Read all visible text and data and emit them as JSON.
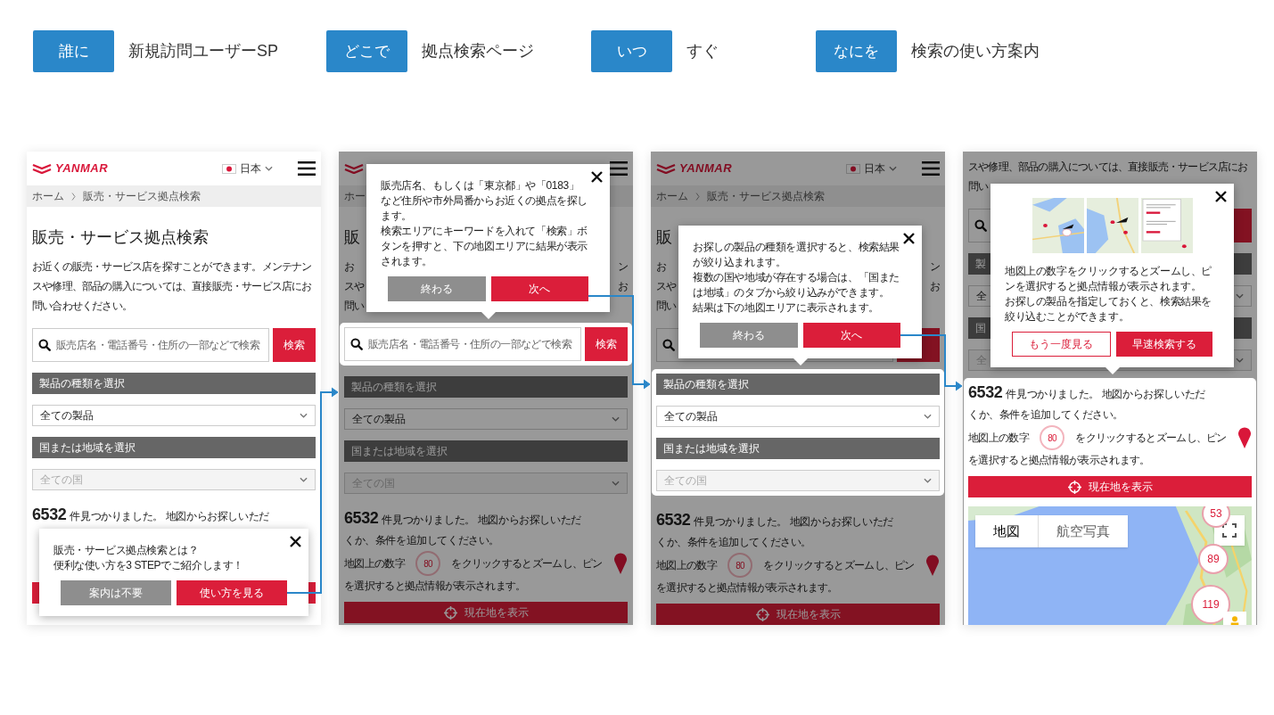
{
  "criteria": [
    {
      "label": "誰に",
      "value": "新規訪問ユーザーSP"
    },
    {
      "label": "どこで",
      "value": "拠点検索ページ"
    },
    {
      "label": "いつ",
      "value": "すぐ"
    },
    {
      "label": "なにを",
      "value": "検索の使い方案内"
    }
  ],
  "panels": [
    {
      "dimmed": false,
      "sections": [
        {
          "highlighted": false,
          "blocks": [
            {
              "kind": "header",
              "logo": "YANMAR",
              "country": "日本"
            },
            {
              "kind": "breadcrumb",
              "items": [
                "ホーム",
                "販売・サービス拠点検索"
              ]
            },
            {
              "kind": "title",
              "text": "販売・サービス拠点検索"
            },
            {
              "kind": "description",
              "lines": [
                {
                  "text": "お近くの販売・サービス店を探すことができます。メンテナン"
                },
                {
                  "text": "スや修理、部品の購入については、直接販売・サービス店にお"
                },
                {
                  "text": "問い合わせください。"
                }
              ]
            },
            {
              "kind": "search",
              "placeholder": "販売店名・電話番号・住所の一部などで検索",
              "button": "検索"
            },
            {
              "kind": "bar",
              "text": "製品の種類を選択"
            },
            {
              "kind": "select",
              "value": "全ての製品",
              "disabled": false
            },
            {
              "kind": "bar",
              "text": "国または地域を選択"
            },
            {
              "kind": "select",
              "value": "全ての国",
              "disabled": true
            },
            {
              "kind": "results",
              "count": "6532",
              "lines": [
                "件見つかりました。 地図からお探しいただ"
              ]
            },
            {
              "kind": "locate"
            }
          ]
        }
      ],
      "popup": {
        "lines": [
          "販売・サービス拠点検索とは？",
          "便利な使い方を3 STEPでご紹介します！"
        ],
        "buttons": [
          {
            "label": "案内は不要",
            "kind": "secondary"
          },
          {
            "label": "使い方を見る",
            "kind": "primary"
          }
        ]
      }
    },
    {
      "dimmed": true,
      "sections": [
        {
          "highlighted": false,
          "blocks": [
            {
              "kind": "header"
            },
            {
              "kind": "breadcrumb",
              "items": [
                "ホー"
              ]
            },
            {
              "kind": "title",
              "text": "販"
            },
            {
              "kind": "description",
              "lines": [
                {
                  "text": "お",
                  "tail": "ン"
                },
                {
                  "text": "スや",
                  "tail": "お"
                },
                {
                  "text": "問い"
                }
              ]
            }
          ]
        },
        {
          "highlighted": true,
          "blocks": [
            {
              "kind": "search",
              "placeholder": "販売店名・電話番号・住所の一部などで検索",
              "button": "検索"
            }
          ],
          "popup": {
            "lines": [
              "販売店名、もしくは「東京都」や「0183」など住所や市外局番からお近くの拠点を探します。",
              "検索エリアにキーワードを入れて「検索」ボタンを押すと、下の地図エリアに結果が表示されます。"
            ],
            "buttons": [
              {
                "label": "終わる",
                "kind": "secondary"
              },
              {
                "label": "次へ",
                "kind": "primary"
              }
            ]
          }
        },
        {
          "highlighted": false,
          "blocks": [
            {
              "kind": "bar",
              "text": "製品の種類を選択"
            },
            {
              "kind": "select",
              "value": "全ての製品",
              "disabled": false
            },
            {
              "kind": "bar",
              "text": "国または地域を選択"
            },
            {
              "kind": "select",
              "value": "全ての国",
              "disabled": true
            },
            {
              "kind": "results",
              "count": "6532",
              "lines": [
                "件見つかりました。 地図からお探しいただ",
                "くか、条件を追加してください。"
              ]
            },
            {
              "kind": "hint",
              "before": "地図上の数字",
              "marker": "80",
              "after": "をクリックするとズームし、ピン",
              "line2": "を選択すると拠点情報が表示されます。"
            },
            {
              "kind": "locate",
              "label": "現在地を表示"
            }
          ]
        }
      ]
    },
    {
      "dimmed": true,
      "sections": [
        {
          "highlighted": false,
          "blocks": [
            {
              "kind": "header",
              "logo": "YANMAR",
              "country": "日本"
            },
            {
              "kind": "breadcrumb",
              "items": [
                "ホーム",
                "販売・サービス拠点検索"
              ]
            },
            {
              "kind": "title",
              "text": "販"
            },
            {
              "kind": "description",
              "lines": [
                {
                  "text": "お",
                  "tail": "ン"
                },
                {
                  "text": "スや",
                  "tail": "お"
                },
                {
                  "text": "問い"
                }
              ]
            },
            {
              "kind": "search"
            }
          ]
        },
        {
          "highlighted": true,
          "blocks": [
            {
              "kind": "bar",
              "text": "製品の種類を選択"
            },
            {
              "kind": "select",
              "value": "全ての製品",
              "disabled": false
            },
            {
              "kind": "bar",
              "text": "国または地域を選択"
            },
            {
              "kind": "select",
              "value": "全ての国",
              "disabled": true
            }
          ],
          "popup": {
            "lines": [
              "お探しの製品の種類を選択すると、検索結果が絞り込まれます。",
              "複数の国や地域が存在する場合は、「国または地域」のタブから絞り込みができます。",
              "結果は下の地図エリアに表示されます。"
            ],
            "buttons": [
              {
                "label": "終わる",
                "kind": "secondary"
              },
              {
                "label": "次へ",
                "kind": "primary"
              }
            ]
          }
        },
        {
          "highlighted": false,
          "blocks": [
            {
              "kind": "results",
              "count": "6532",
              "lines": [
                "件見つかりました。 地図からお探しいただ",
                "くか、条件を追加してください。"
              ]
            },
            {
              "kind": "hint",
              "before": "地図上の数字",
              "marker": "80",
              "after": "をクリックするとズームし、ピン",
              "line2": "を選択すると拠点情報が表示されます。"
            },
            {
              "kind": "locate",
              "label": "現在地を表示"
            }
          ]
        }
      ]
    },
    {
      "dimmed": true,
      "sections": [
        {
          "highlighted": false,
          "blocks": [
            {
              "kind": "description",
              "lines": [
                {
                  "text": "スや修理、部品の購入については、直接販売・サービス店にお"
                },
                {
                  "text": "問い"
                }
              ]
            },
            {
              "kind": "search"
            },
            {
              "kind": "bar",
              "text": "製"
            },
            {
              "kind": "select",
              "value": "全",
              "disabled": false
            },
            {
              "kind": "bar",
              "text": "国"
            },
            {
              "kind": "select",
              "value": "全",
              "disabled": true
            }
          ]
        },
        {
          "highlighted": true,
          "blocks": [
            {
              "kind": "results",
              "count": "6532",
              "lines": [
                "件見つかりました。 地図からお探しいただ",
                "くか、条件を追加してください。"
              ]
            },
            {
              "kind": "hint",
              "before": "地図上の数字",
              "marker": "80",
              "after": "をクリックするとズームし、ピン",
              "line2": "を選択すると拠点情報が表示されます。"
            },
            {
              "kind": "locate",
              "label": "現在地を表示"
            },
            {
              "kind": "map",
              "tabs": [
                {
                  "label": "地図",
                  "selected": true
                },
                {
                  "label": "航空写真",
                  "selected": false
                }
              ],
              "markers": [
                "53",
                "89",
                "119"
              ]
            }
          ],
          "popup": {
            "images": [
              {
                "kind": "picture"
              },
              {
                "kind": "picture"
              },
              {
                "kind": "picture"
              }
            ],
            "lines": [
              "地図上の数字をクリックするとズームし、ピンを選択すると拠点情報が表示されます。",
              "お探しの製品を指定しておくと、検索結果を絞り込むことができます。"
            ],
            "buttons": [
              {
                "label": "もう一度見る",
                "kind": "outline"
              },
              {
                "label": "早速検索する",
                "kind": "primary"
              }
            ]
          }
        }
      ]
    }
  ]
}
